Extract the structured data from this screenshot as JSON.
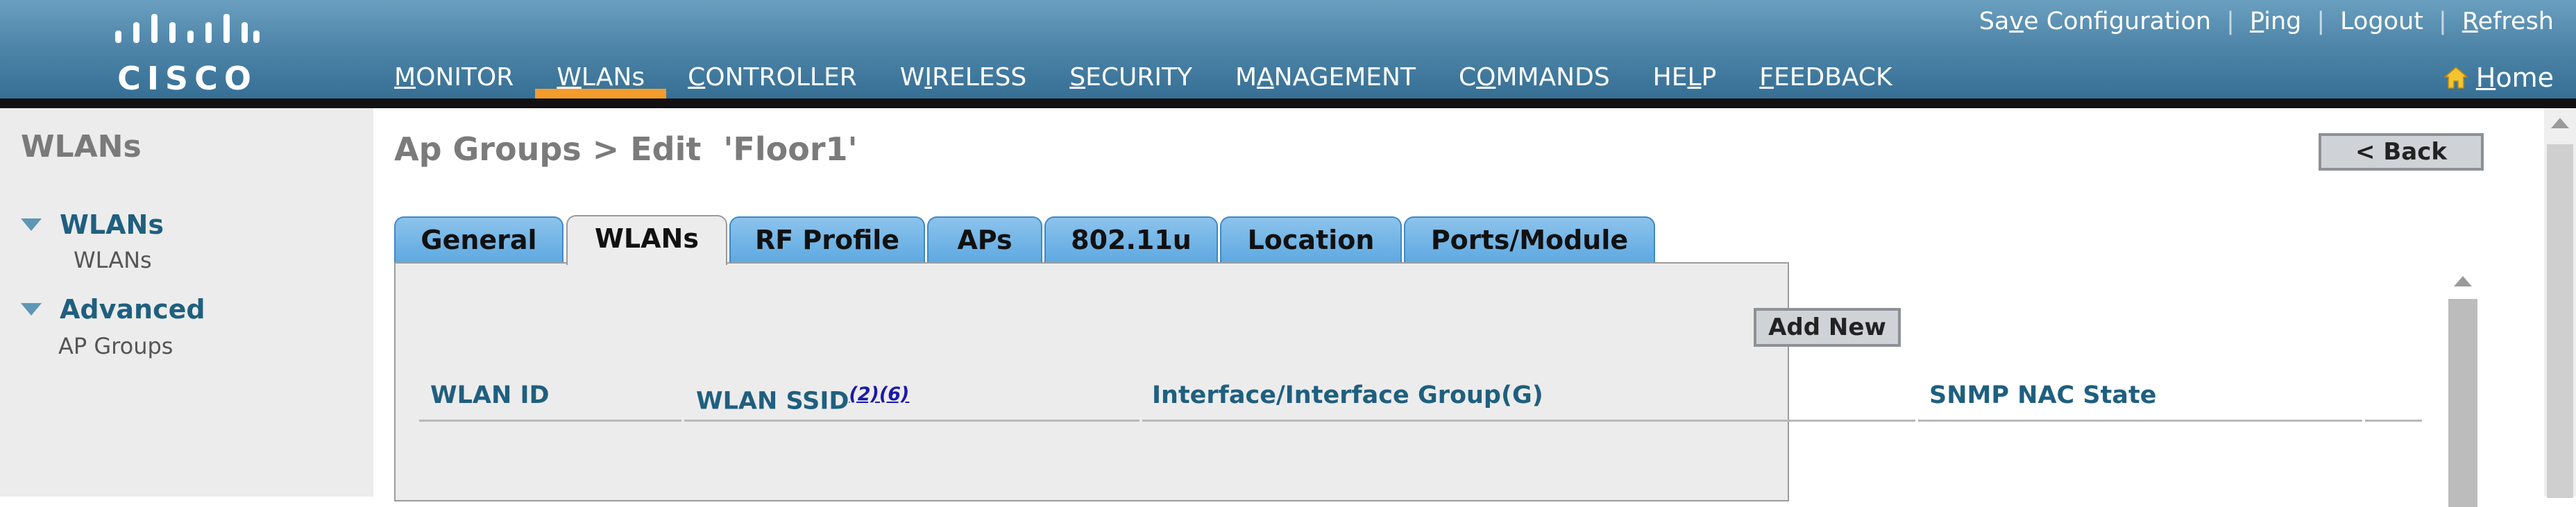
{
  "brand": {
    "name": "CISCO"
  },
  "header_links": {
    "save_configuration": "Save Configuration",
    "ping": "Ping",
    "logout": "Logout",
    "refresh": "Refresh",
    "separator": "|"
  },
  "nav": {
    "active": "WLANs",
    "items": [
      "MONITOR",
      "WLANs",
      "CONTROLLER",
      "WIRELESS",
      "SECURITY",
      "MANAGEMENT",
      "COMMANDS",
      "HELP",
      "FEEDBACK"
    ]
  },
  "home": {
    "label": "Home",
    "icon": "house-icon"
  },
  "sidebar": {
    "title": "WLANs",
    "sections": [
      {
        "label": "WLANs",
        "items": [
          "WLANs"
        ]
      },
      {
        "label": "Advanced",
        "items": [
          "AP Groups"
        ]
      }
    ]
  },
  "page": {
    "title": "Ap Groups > Edit  'Floor1'",
    "back_label": "< Back"
  },
  "tabs": {
    "active": "WLANs",
    "items": [
      "General",
      "WLANs",
      "RF Profile",
      "APs",
      "802.11u",
      "Location",
      "Ports/Module"
    ]
  },
  "wlans_tab": {
    "add_new_label": "Add New",
    "columns": {
      "wlan_id": "WLAN ID",
      "wlan_ssid": "WLAN SSID",
      "ssid_footnotes": "(2)(6)",
      "interface": "Interface/Interface Group(G)",
      "snmp_nac": "SNMP NAC State"
    },
    "rows": []
  },
  "colors": {
    "header_top": "#6a9fbf",
    "header_bottom": "#366f95",
    "active_nav_underline": "#f39c2b",
    "tab_blue": "#6aaee3",
    "heading_blue": "#1f5f7f",
    "footnote_link": "#1a1aa8"
  }
}
